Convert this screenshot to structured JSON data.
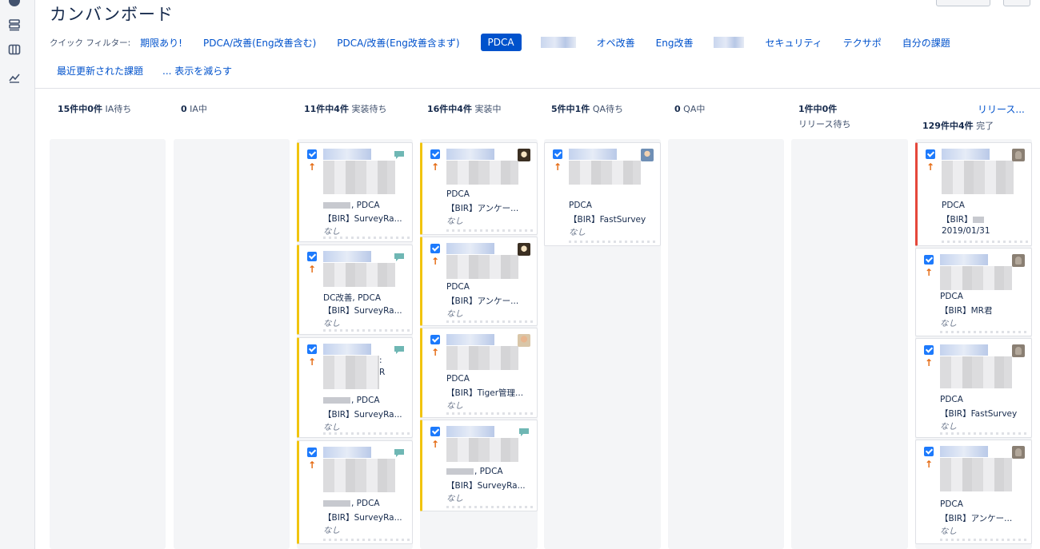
{
  "board": {
    "title": "カンバンボード"
  },
  "quick_filters": {
    "label": "クイック フィルター:",
    "row1": [
      "期限あり!",
      "PDCA/改善(Eng改善含む)",
      "PDCA/改善(Eng改善含まず)",
      "PDCA",
      "",
      "オペ改善",
      "Eng改善",
      "",
      "セキュリティ",
      "テクサポ",
      "自分の課題"
    ],
    "active_filter": "PDCA",
    "row2": [
      "最近更新された課題",
      "... 表示を減らす"
    ]
  },
  "columns": [
    {
      "count": "15件中0件",
      "name": "IA待ち"
    },
    {
      "count": "0",
      "name": "IA中"
    },
    {
      "count": "11件中4件",
      "name": "実装待ち"
    },
    {
      "count": "16件中4件",
      "name": "実装中"
    },
    {
      "count": "5件中1件",
      "name": "QA待ち"
    },
    {
      "count": "0",
      "name": "QA中"
    },
    {
      "count": "1件中0件",
      "name": "リリース待ち"
    },
    {
      "count": "129件中4件",
      "name": "完了"
    }
  ],
  "release_link": "リリース...",
  "cards": {
    "c3": [
      {
        "line1": ", PDCA",
        "line2": "【BIR】SurveyRa...",
        "line3": "なし",
        "avatar": "chat-icon"
      },
      {
        "line1": "DC改善, PDCA",
        "line2": "【BIR】SurveyRa...",
        "line3": "なし",
        "avatar": "chat-icon"
      },
      {
        "line1": ", PDCA",
        "line2": "【BIR】SurveyRa...",
        "line3": "なし",
        "avatar": "chat-icon",
        "extra": ":",
        "extra2": "R"
      },
      {
        "line1": ", PDCA",
        "line2": "【BIR】SurveyRa...",
        "line3": "なし",
        "avatar": "chat-icon"
      }
    ],
    "c4": [
      {
        "line1": "PDCA",
        "line2": "【BIR】アンケー...",
        "line3": "なし",
        "avatar": "user-photo"
      },
      {
        "line1": "PDCA",
        "line2": "【BIR】アンケー...",
        "line3": "なし",
        "avatar": "user-photo"
      },
      {
        "line1": "PDCA",
        "line2": "【BIR】Tiger管理...",
        "line3": "なし",
        "avatar": "user-photo"
      },
      {
        "line1": ", PDCA",
        "line2": "【BIR】SurveyRa...",
        "line3": "なし",
        "avatar": "chat-icon"
      }
    ],
    "c5": [
      {
        "line1": "PDCA",
        "line2": "【BIR】FastSurvey",
        "line3": "なし",
        "avatar": "user-photo"
      }
    ],
    "c8": [
      {
        "line1": "PDCA",
        "line2": "【BIR】",
        "line3": "2019/01/31",
        "avatar": "user-avatar"
      },
      {
        "line1": "PDCA",
        "line2": "【BIR】MR君",
        "line3": "なし",
        "avatar": "user-avatar"
      },
      {
        "line1": "PDCA",
        "line2": "【BIR】FastSurvey",
        "line3": "なし",
        "avatar": "user-avatar"
      },
      {
        "line1": "PDCA",
        "line2": "【BIR】アンケー...",
        "line3": "なし",
        "avatar": "user-avatar"
      }
    ]
  },
  "colors": {
    "accent": "#0052cc",
    "priority": "#e56910",
    "checkbox": "#1d7afc",
    "stripe_yellow": "#f1c40f",
    "stripe_red": "#e5483b"
  }
}
